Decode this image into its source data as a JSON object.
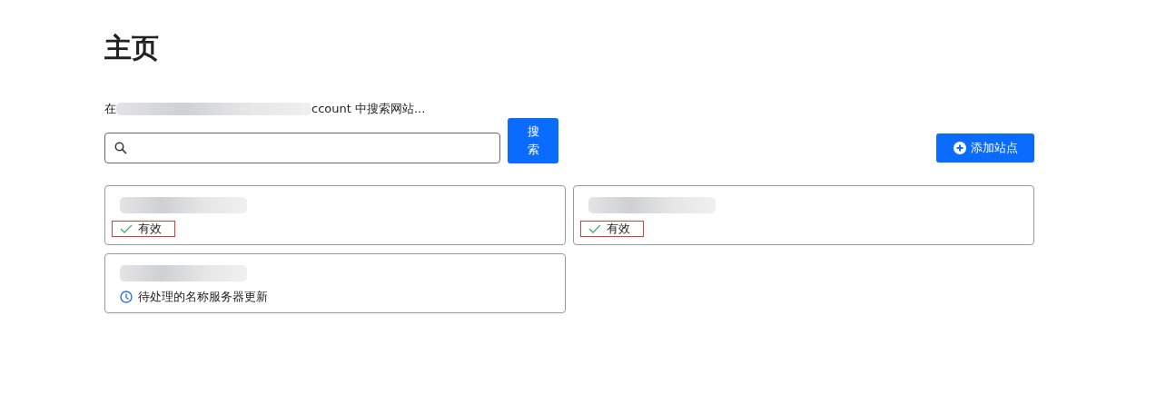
{
  "page_title": "主页",
  "search": {
    "label_start": "在",
    "label_end": "ccount 中搜索网站...",
    "button": "搜索"
  },
  "add_button": "添加站点",
  "sites": [
    {
      "status": "有效",
      "kind": "active",
      "highlighted": true
    },
    {
      "status": "有效",
      "kind": "active",
      "highlighted": true
    },
    {
      "status": "待处理的名称服务器更新",
      "kind": "pending",
      "highlighted": false
    }
  ]
}
